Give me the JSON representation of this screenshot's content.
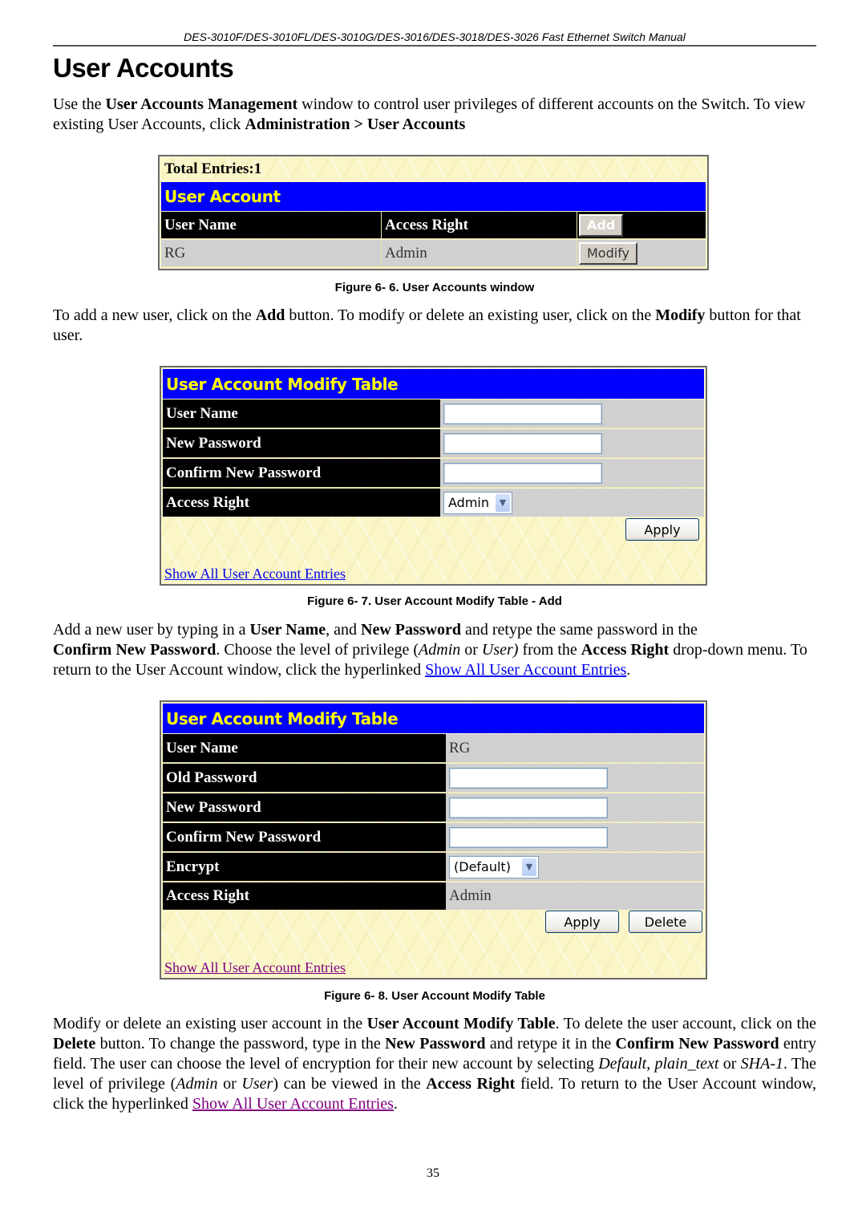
{
  "header": {
    "running_title": "DES-3010F/DES-3010FL/DES-3010G/DES-3016/DES-3018/DES-3026 Fast Ethernet Switch Manual",
    "page_title": "User Accounts"
  },
  "intro": {
    "t1": "Use the ",
    "b1": "User Accounts Management",
    "t2": " window to control user privileges of different accounts on the Switch. To view existing User Accounts, click ",
    "b2": "Administration > User Accounts"
  },
  "figure6": {
    "total_entries": "Total Entries:1",
    "title": "User Account",
    "columns": [
      "User Name",
      "Access Right"
    ],
    "add_button": "Add",
    "rows": [
      {
        "user_name": "RG",
        "access_right": "Admin",
        "modify_button": "Modify"
      }
    ],
    "caption": "Figure 6- 6. User Accounts window"
  },
  "para2": {
    "t1": "To add a new user, click on the ",
    "b1": "Add",
    "t2": " button. To modify or delete an existing user, click on the ",
    "b2": "Modify",
    "t3": " button for that user."
  },
  "figure7": {
    "title": "User Account Modify Table",
    "fields": [
      {
        "label": "User Name",
        "value": ""
      },
      {
        "label": "New Password",
        "value": ""
      },
      {
        "label": "Confirm New Password",
        "value": ""
      },
      {
        "label": "Access Right",
        "selected": "Admin"
      }
    ],
    "apply_button": "Apply",
    "link": "Show All User Account Entries",
    "caption": "Figure 6- 7. User Account Modify Table - Add"
  },
  "para3": {
    "t1": "Add a new user by typing in a ",
    "b1": "User Name",
    "t2": ", and ",
    "b2": "New Password",
    "t3": " and retype the same password in the ",
    "b3": "Confirm New Password",
    "t4": ". Choose the level of privilege (",
    "i1": "Admin",
    "t5": " or ",
    "i2": "User)",
    "t6": " from the ",
    "b4": "Access Right",
    "t7": " drop-down menu. To return to the User Account window, click the hyperlinked ",
    "link": "Show All User Account Entries",
    "t8": "."
  },
  "figure8": {
    "title": "User Account Modify Table",
    "fields": [
      {
        "label": "User Name",
        "value": "RG"
      },
      {
        "label": "Old Password",
        "value": ""
      },
      {
        "label": "New Password",
        "value": ""
      },
      {
        "label": "Confirm New Password",
        "value": ""
      },
      {
        "label": "Encrypt",
        "selected": "(Default)"
      },
      {
        "label": "Access Right",
        "value": "Admin"
      }
    ],
    "apply_button": "Apply",
    "delete_button": "Delete",
    "link": "Show All User Account Entries",
    "caption": "Figure 6- 8. User Account Modify Table"
  },
  "para4": {
    "t1": "Modify or delete an existing user account in the ",
    "b1": "User Account Modify Table",
    "t2": ". To delete the user account, click on the ",
    "b2": "Delete",
    "t3": " button. To change the password, type in the ",
    "b3": "New Password",
    "t4": " and retype it in the ",
    "b4": "Confirm New Password",
    "t5": " entry field. The user can choose the level of encryption for their new account by selecting ",
    "i1": "Default",
    "t6": ", ",
    "i2": "plain_text",
    "t7": " or ",
    "i3": "SHA-1",
    "t8": ". The level of privilege (",
    "i4": "Admin",
    "t9": " or ",
    "i5": "User",
    "t10": ") can be viewed in the ",
    "b5": "Access Right",
    "t11": " field. To return to the User Account window, click the hyperlinked ",
    "link": "Show All User Account Entries",
    "t12": "."
  },
  "footer": {
    "page_number": "35"
  },
  "colors": {
    "title_bar_bg": "#0000ff",
    "title_bar_text": "#ffff00",
    "label_bg": "#000000",
    "value_bg": "#d0d0d0",
    "panel_bg": "#faf6c8",
    "link": "#0000ee",
    "visited_link": "#800080"
  }
}
